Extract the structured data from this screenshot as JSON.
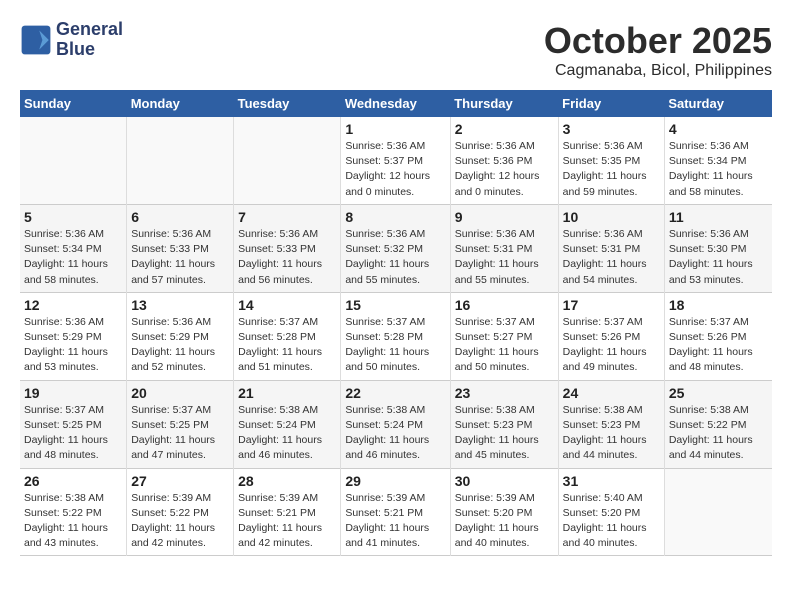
{
  "header": {
    "logo_line1": "General",
    "logo_line2": "Blue",
    "month": "October 2025",
    "location": "Cagmanaba, Bicol, Philippines"
  },
  "weekdays": [
    "Sunday",
    "Monday",
    "Tuesday",
    "Wednesday",
    "Thursday",
    "Friday",
    "Saturday"
  ],
  "weeks": [
    [
      {
        "day": "",
        "info": ""
      },
      {
        "day": "",
        "info": ""
      },
      {
        "day": "",
        "info": ""
      },
      {
        "day": "1",
        "info": "Sunrise: 5:36 AM\nSunset: 5:37 PM\nDaylight: 12 hours\nand 0 minutes."
      },
      {
        "day": "2",
        "info": "Sunrise: 5:36 AM\nSunset: 5:36 PM\nDaylight: 12 hours\nand 0 minutes."
      },
      {
        "day": "3",
        "info": "Sunrise: 5:36 AM\nSunset: 5:35 PM\nDaylight: 11 hours\nand 59 minutes."
      },
      {
        "day": "4",
        "info": "Sunrise: 5:36 AM\nSunset: 5:34 PM\nDaylight: 11 hours\nand 58 minutes."
      }
    ],
    [
      {
        "day": "5",
        "info": "Sunrise: 5:36 AM\nSunset: 5:34 PM\nDaylight: 11 hours\nand 58 minutes."
      },
      {
        "day": "6",
        "info": "Sunrise: 5:36 AM\nSunset: 5:33 PM\nDaylight: 11 hours\nand 57 minutes."
      },
      {
        "day": "7",
        "info": "Sunrise: 5:36 AM\nSunset: 5:33 PM\nDaylight: 11 hours\nand 56 minutes."
      },
      {
        "day": "8",
        "info": "Sunrise: 5:36 AM\nSunset: 5:32 PM\nDaylight: 11 hours\nand 55 minutes."
      },
      {
        "day": "9",
        "info": "Sunrise: 5:36 AM\nSunset: 5:31 PM\nDaylight: 11 hours\nand 55 minutes."
      },
      {
        "day": "10",
        "info": "Sunrise: 5:36 AM\nSunset: 5:31 PM\nDaylight: 11 hours\nand 54 minutes."
      },
      {
        "day": "11",
        "info": "Sunrise: 5:36 AM\nSunset: 5:30 PM\nDaylight: 11 hours\nand 53 minutes."
      }
    ],
    [
      {
        "day": "12",
        "info": "Sunrise: 5:36 AM\nSunset: 5:29 PM\nDaylight: 11 hours\nand 53 minutes."
      },
      {
        "day": "13",
        "info": "Sunrise: 5:36 AM\nSunset: 5:29 PM\nDaylight: 11 hours\nand 52 minutes."
      },
      {
        "day": "14",
        "info": "Sunrise: 5:37 AM\nSunset: 5:28 PM\nDaylight: 11 hours\nand 51 minutes."
      },
      {
        "day": "15",
        "info": "Sunrise: 5:37 AM\nSunset: 5:28 PM\nDaylight: 11 hours\nand 50 minutes."
      },
      {
        "day": "16",
        "info": "Sunrise: 5:37 AM\nSunset: 5:27 PM\nDaylight: 11 hours\nand 50 minutes."
      },
      {
        "day": "17",
        "info": "Sunrise: 5:37 AM\nSunset: 5:26 PM\nDaylight: 11 hours\nand 49 minutes."
      },
      {
        "day": "18",
        "info": "Sunrise: 5:37 AM\nSunset: 5:26 PM\nDaylight: 11 hours\nand 48 minutes."
      }
    ],
    [
      {
        "day": "19",
        "info": "Sunrise: 5:37 AM\nSunset: 5:25 PM\nDaylight: 11 hours\nand 48 minutes."
      },
      {
        "day": "20",
        "info": "Sunrise: 5:37 AM\nSunset: 5:25 PM\nDaylight: 11 hours\nand 47 minutes."
      },
      {
        "day": "21",
        "info": "Sunrise: 5:38 AM\nSunset: 5:24 PM\nDaylight: 11 hours\nand 46 minutes."
      },
      {
        "day": "22",
        "info": "Sunrise: 5:38 AM\nSunset: 5:24 PM\nDaylight: 11 hours\nand 46 minutes."
      },
      {
        "day": "23",
        "info": "Sunrise: 5:38 AM\nSunset: 5:23 PM\nDaylight: 11 hours\nand 45 minutes."
      },
      {
        "day": "24",
        "info": "Sunrise: 5:38 AM\nSunset: 5:23 PM\nDaylight: 11 hours\nand 44 minutes."
      },
      {
        "day": "25",
        "info": "Sunrise: 5:38 AM\nSunset: 5:22 PM\nDaylight: 11 hours\nand 44 minutes."
      }
    ],
    [
      {
        "day": "26",
        "info": "Sunrise: 5:38 AM\nSunset: 5:22 PM\nDaylight: 11 hours\nand 43 minutes."
      },
      {
        "day": "27",
        "info": "Sunrise: 5:39 AM\nSunset: 5:22 PM\nDaylight: 11 hours\nand 42 minutes."
      },
      {
        "day": "28",
        "info": "Sunrise: 5:39 AM\nSunset: 5:21 PM\nDaylight: 11 hours\nand 42 minutes."
      },
      {
        "day": "29",
        "info": "Sunrise: 5:39 AM\nSunset: 5:21 PM\nDaylight: 11 hours\nand 41 minutes."
      },
      {
        "day": "30",
        "info": "Sunrise: 5:39 AM\nSunset: 5:20 PM\nDaylight: 11 hours\nand 40 minutes."
      },
      {
        "day": "31",
        "info": "Sunrise: 5:40 AM\nSunset: 5:20 PM\nDaylight: 11 hours\nand 40 minutes."
      },
      {
        "day": "",
        "info": ""
      }
    ]
  ]
}
